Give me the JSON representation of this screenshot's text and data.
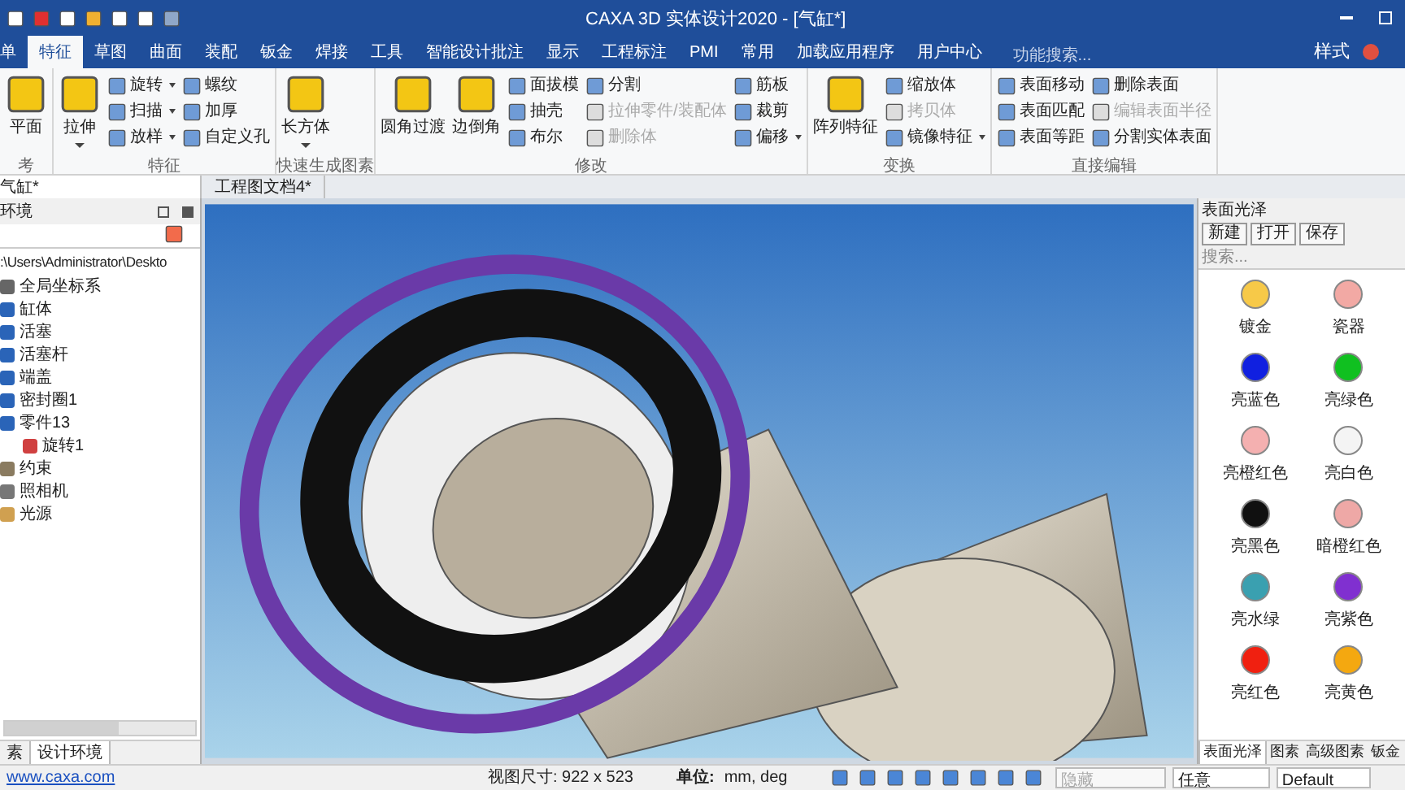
{
  "window": {
    "title": "CAXA 3D 实体设计2020 - [气缸*]"
  },
  "menu_tabs": [
    {
      "label": "单",
      "selected": false
    },
    {
      "label": "特征",
      "selected": true
    },
    {
      "label": "草图",
      "selected": false
    },
    {
      "label": "曲面",
      "selected": false
    },
    {
      "label": "装配",
      "selected": false
    },
    {
      "label": "钣金",
      "selected": false
    },
    {
      "label": "焊接",
      "selected": false
    },
    {
      "label": "工具",
      "selected": false
    },
    {
      "label": "智能设计批注",
      "selected": false
    },
    {
      "label": "显示",
      "selected": false
    },
    {
      "label": "工程标注",
      "selected": false
    },
    {
      "label": "PMI",
      "selected": false
    },
    {
      "label": "常用",
      "selected": false
    },
    {
      "label": "加载应用程序",
      "selected": false
    },
    {
      "label": "用户中心",
      "selected": false
    }
  ],
  "feature_search": {
    "placeholder": "功能搜索..."
  },
  "style_menu": "样式",
  "ribbon_groups": [
    {
      "label": "考",
      "large": [
        {
          "label": "平面",
          "dropdown": false
        }
      ]
    },
    {
      "label": "特征",
      "large": [
        {
          "label": "拉伸",
          "dropdown": true
        }
      ],
      "columns": [
        [
          {
            "label": "旋转",
            "dropdown": true,
            "disabled": false
          },
          {
            "label": "扫描",
            "dropdown": true,
            "disabled": false
          },
          {
            "label": "放样",
            "dropdown": true,
            "disabled": false
          }
        ],
        [
          {
            "label": "螺纹",
            "dropdown": false,
            "disabled": false
          },
          {
            "label": "加厚",
            "dropdown": false,
            "disabled": false
          },
          {
            "label": "自定义孔",
            "dropdown": false,
            "disabled": false
          }
        ]
      ]
    },
    {
      "label": "快速生成图素",
      "large": [
        {
          "label": "长方体",
          "dropdown": true
        }
      ]
    },
    {
      "label": "修改",
      "large": [
        {
          "label": "圆角过渡",
          "dropdown": false
        },
        {
          "label": "边倒角",
          "dropdown": false
        }
      ],
      "columns": [
        [
          {
            "label": "面拔模",
            "dropdown": false,
            "disabled": false
          },
          {
            "label": "抽壳",
            "dropdown": false,
            "disabled": false
          },
          {
            "label": "布尔",
            "dropdown": false,
            "disabled": false
          }
        ],
        [
          {
            "label": "分割",
            "dropdown": false,
            "disabled": false
          },
          {
            "label": "拉伸零件/装配体",
            "dropdown": false,
            "disabled": true
          },
          {
            "label": "删除体",
            "dropdown": false,
            "disabled": true
          }
        ],
        [
          {
            "label": "筋板",
            "dropdown": false,
            "disabled": false
          },
          {
            "label": "裁剪",
            "dropdown": false,
            "disabled": false
          },
          {
            "label": "偏移",
            "dropdown": true,
            "disabled": false
          }
        ]
      ]
    },
    {
      "label": "变换",
      "large": [
        {
          "label": "阵列特征",
          "dropdown": false
        }
      ],
      "columns": [
        [
          {
            "label": "缩放体",
            "dropdown": false,
            "disabled": false
          },
          {
            "label": "拷贝体",
            "dropdown": false,
            "disabled": true
          },
          {
            "label": "镜像特征",
            "dropdown": true,
            "disabled": false
          }
        ]
      ]
    },
    {
      "label": "直接编辑",
      "columns": [
        [
          {
            "label": "表面移动",
            "dropdown": false,
            "disabled": false
          },
          {
            "label": "表面匹配",
            "dropdown": false,
            "disabled": false
          },
          {
            "label": "表面等距",
            "dropdown": false,
            "disabled": false
          }
        ],
        [
          {
            "label": "删除表面",
            "dropdown": false,
            "disabled": false
          },
          {
            "label": "编辑表面半径",
            "dropdown": false,
            "disabled": true
          },
          {
            "label": "分割实体表面",
            "dropdown": false,
            "disabled": false
          }
        ]
      ]
    }
  ],
  "document_tabs": [
    {
      "label": "气缸*",
      "selected": true
    },
    {
      "label": "工程图文档4*",
      "selected": false
    }
  ],
  "left_panel": {
    "title": "环境",
    "path": ":\\Users\\Administrator\\Deskto",
    "tree": [
      {
        "label": "全局坐标系",
        "kind": "axes"
      },
      {
        "label": "缸体",
        "kind": "part"
      },
      {
        "label": "活塞",
        "kind": "part"
      },
      {
        "label": "活塞杆",
        "kind": "part"
      },
      {
        "label": "端盖",
        "kind": "part"
      },
      {
        "label": "密封圈1",
        "kind": "part"
      },
      {
        "label": "零件13",
        "kind": "part",
        "children": [
          {
            "label": "旋转1",
            "kind": "feature"
          }
        ]
      },
      {
        "label": "约束",
        "kind": "constraint"
      },
      {
        "label": "照相机",
        "kind": "camera"
      },
      {
        "label": "光源",
        "kind": "light"
      }
    ],
    "tabs": [
      {
        "label": "素",
        "selected": false
      },
      {
        "label": "设计环境",
        "selected": true
      }
    ]
  },
  "right_panel": {
    "title": "表面光泽",
    "buttons": [
      "新建",
      "打开",
      "保存"
    ],
    "search": {
      "placeholder": "搜索..."
    },
    "materials": [
      {
        "label": "镀金",
        "color": "#f7c948"
      },
      {
        "label": "瓷器",
        "color": "#f2a9a4"
      },
      {
        "label": "亮蓝色",
        "color": "#1020e0"
      },
      {
        "label": "亮绿色",
        "color": "#10c020"
      },
      {
        "label": "亮橙红色",
        "color": "#f4b0b0"
      },
      {
        "label": "亮白色",
        "color": "#f4f4f4"
      },
      {
        "label": "亮黑色",
        "color": "#101010"
      },
      {
        "label": "暗橙红色",
        "color": "#eea8a6"
      },
      {
        "label": "亮水绿",
        "color": "#3aa0b0"
      },
      {
        "label": "亮紫色",
        "color": "#8030d0"
      },
      {
        "label": "亮红色",
        "color": "#f02010"
      },
      {
        "label": "亮黄色",
        "color": "#f4a810"
      }
    ],
    "tabs": [
      {
        "label": "表面光泽",
        "selected": true
      },
      {
        "label": "图素",
        "selected": false
      },
      {
        "label": "高级图素",
        "selected": false
      },
      {
        "label": "钣金",
        "selected": false
      }
    ]
  },
  "status_bar": {
    "link": "www.caxa.com",
    "view_size": "视图尺寸: 922 x 523",
    "unit_label": "单位:",
    "unit_value": "mm, deg",
    "filter": "隐藏",
    "snap": "任意",
    "style": "Default"
  }
}
